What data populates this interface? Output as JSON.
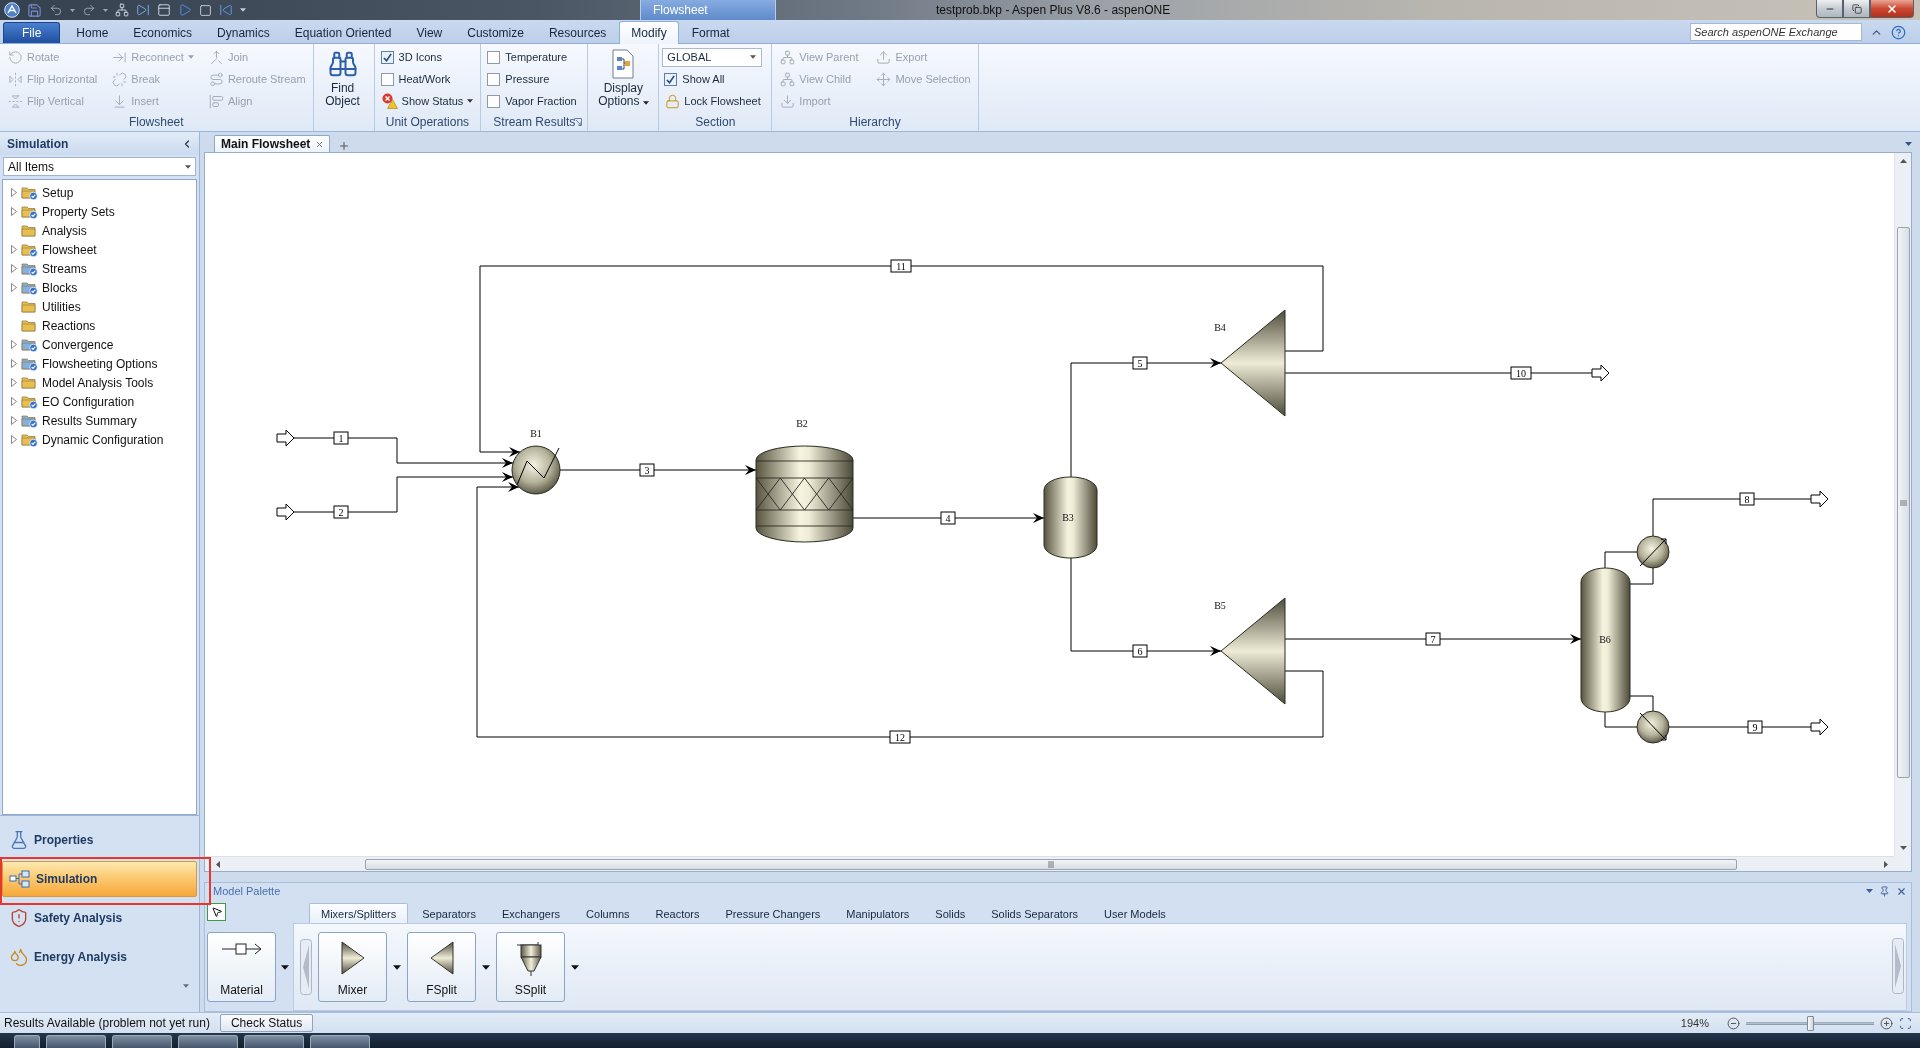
{
  "window": {
    "title": "testprob.bkp - Aspen Plus V8.6 - aspenONE",
    "context_tab": "Flowsheet"
  },
  "ribbon": {
    "tabs": [
      {
        "label": "File",
        "kind": "file",
        "selected": false
      },
      {
        "label": "Home",
        "kind": "tab",
        "selected": false
      },
      {
        "label": "Economics",
        "kind": "tab",
        "selected": false
      },
      {
        "label": "Dynamics",
        "kind": "tab",
        "selected": false
      },
      {
        "label": "Equation Oriented",
        "kind": "tab",
        "selected": false
      },
      {
        "label": "View",
        "kind": "tab",
        "selected": false
      },
      {
        "label": "Customize",
        "kind": "tab",
        "selected": false
      },
      {
        "label": "Resources",
        "kind": "tab",
        "selected": false
      },
      {
        "label": "Modify",
        "kind": "tab",
        "selected": true
      },
      {
        "label": "Format",
        "kind": "tab",
        "selected": false
      }
    ],
    "search": {
      "placeholder": "Search aspenONE Exchange"
    },
    "groups": [
      {
        "label": "Flowsheet",
        "launcher": false,
        "items": [
          {
            "kind": "small",
            "label": "Rotate",
            "disabled": true,
            "menu": false
          },
          {
            "kind": "small",
            "label": "Flip Horizontal",
            "disabled": true,
            "menu": false
          },
          {
            "kind": "small",
            "label": "Flip Vertical",
            "disabled": true,
            "menu": false
          },
          {
            "kind": "small",
            "label": "Reconnect",
            "disabled": true,
            "menu": true
          },
          {
            "kind": "small",
            "label": "Break",
            "disabled": true,
            "menu": false
          },
          {
            "kind": "small",
            "label": "Insert",
            "disabled": true,
            "menu": false
          },
          {
            "kind": "small",
            "label": "Join",
            "disabled": true,
            "menu": false
          },
          {
            "kind": "small",
            "label": "Reroute Stream",
            "disabled": true,
            "menu": false
          },
          {
            "kind": "small",
            "label": "Align",
            "disabled": true,
            "menu": false
          }
        ]
      },
      {
        "launcher": false,
        "items": [
          {
            "kind": "large",
            "label": "Find Object",
            "disabled": false,
            "menu": false
          }
        ]
      },
      {
        "label": "Unit Operations",
        "launcher": false,
        "items": [
          {
            "kind": "checkbox",
            "label": "3D Icons",
            "checked": true
          },
          {
            "kind": "checkbox",
            "label": "Heat/Work",
            "checked": false
          },
          {
            "kind": "small",
            "label": "Show Status",
            "disabled": false,
            "menu": true
          }
        ]
      },
      {
        "label": "Stream Results",
        "launcher": true,
        "items": [
          {
            "kind": "checkbox",
            "label": "Temperature",
            "checked": false
          },
          {
            "kind": "checkbox",
            "label": "Pressure",
            "checked": false
          },
          {
            "kind": "checkbox",
            "label": "Vapor Fraction",
            "checked": false
          }
        ]
      },
      {
        "launcher": false,
        "items": [
          {
            "kind": "large",
            "label": "Display Options",
            "disabled": false,
            "menu": true
          }
        ]
      },
      {
        "label": "Section",
        "launcher": false,
        "items": [
          {
            "kind": "select",
            "value": "GLOBAL"
          },
          {
            "kind": "checkbox",
            "label": "Show All",
            "checked": true
          },
          {
            "kind": "small",
            "label": "Lock Flowsheet",
            "disabled": false,
            "menu": false
          }
        ]
      },
      {
        "label": "Hierarchy",
        "launcher": false,
        "items": [
          {
            "kind": "small",
            "label": "View Parent",
            "disabled": true,
            "menu": false
          },
          {
            "kind": "small",
            "label": "View Child",
            "disabled": true,
            "menu": false
          },
          {
            "kind": "small",
            "label": "Import",
            "disabled": true,
            "menu": false
          },
          {
            "kind": "small",
            "label": "Export",
            "disabled": true,
            "menu": false
          },
          {
            "kind": "small",
            "label": "Move Selection",
            "disabled": true,
            "menu": false
          }
        ]
      }
    ]
  },
  "navigator": {
    "title": "Simulation",
    "filter": "All Items",
    "items": [
      {
        "label": "Setup",
        "expandable": true,
        "complete": true,
        "color": "#e8bf4f"
      },
      {
        "label": "Property Sets",
        "expandable": true,
        "complete": true,
        "color": "#e8bf4f"
      },
      {
        "label": "Analysis",
        "expandable": false,
        "complete": false,
        "color": "#e8bf4f"
      },
      {
        "label": "Flowsheet",
        "expandable": true,
        "complete": true,
        "color": "#e8bf4f"
      },
      {
        "label": "Streams",
        "expandable": true,
        "complete": true,
        "color": "#86b0da"
      },
      {
        "label": "Blocks",
        "expandable": true,
        "complete": true,
        "color": "#86b0da"
      },
      {
        "label": "Utilities",
        "expandable": false,
        "complete": false,
        "color": "#e8bf4f"
      },
      {
        "label": "Reactions",
        "expandable": false,
        "complete": false,
        "color": "#e8bf4f"
      },
      {
        "label": "Convergence",
        "expandable": true,
        "complete": true,
        "color": "#86b0da"
      },
      {
        "label": "Flowsheeting Options",
        "expandable": true,
        "complete": true,
        "color": "#86b0da"
      },
      {
        "label": "Model Analysis Tools",
        "expandable": true,
        "complete": false,
        "color": "#e8bf4f"
      },
      {
        "label": "EO Configuration",
        "expandable": true,
        "complete": true,
        "color": "#e8bf4f"
      },
      {
        "label": "Results Summary",
        "expandable": true,
        "complete": true,
        "color": "#86b0da"
      },
      {
        "label": "Dynamic Configuration",
        "expandable": true,
        "complete": true,
        "color": "#e8bf4f"
      }
    ]
  },
  "modules": [
    {
      "label": "Properties",
      "selected": false,
      "highlighted": false
    },
    {
      "label": "Simulation",
      "selected": true,
      "highlighted": true
    },
    {
      "label": "Safety Analysis",
      "selected": false,
      "highlighted": false
    },
    {
      "label": "Energy Analysis",
      "selected": false,
      "highlighted": false
    }
  ],
  "documents": [
    {
      "label": "Main Flowsheet",
      "selected": true
    }
  ],
  "flowsheet": {
    "blocks": [
      {
        "label": "B1",
        "kind": "heater"
      },
      {
        "label": "B2",
        "kind": "reactor"
      },
      {
        "label": "B3",
        "kind": "flash"
      },
      {
        "label": "B4",
        "kind": "splitter"
      },
      {
        "label": "B5",
        "kind": "splitter"
      },
      {
        "label": "B6",
        "kind": "column"
      }
    ],
    "streams": [
      {
        "label": "1",
        "kind": "feed"
      },
      {
        "label": "2",
        "kind": "feed"
      },
      {
        "label": "3",
        "kind": "internal"
      },
      {
        "label": "4",
        "kind": "internal"
      },
      {
        "label": "5",
        "kind": "internal"
      },
      {
        "label": "6",
        "kind": "internal"
      },
      {
        "label": "7",
        "kind": "internal"
      },
      {
        "label": "8",
        "kind": "product"
      },
      {
        "label": "9",
        "kind": "product"
      },
      {
        "label": "10",
        "kind": "product"
      },
      {
        "label": "11",
        "kind": "internal"
      },
      {
        "label": "12",
        "kind": "internal"
      }
    ]
  },
  "palette": {
    "title": "Model Palette",
    "tabs": [
      {
        "label": "Mixers/Splitters",
        "selected": true
      },
      {
        "label": "Separators",
        "selected": false
      },
      {
        "label": "Exchangers",
        "selected": false
      },
      {
        "label": "Columns",
        "selected": false
      },
      {
        "label": "Reactors",
        "selected": false
      },
      {
        "label": "Pressure Changers",
        "selected": false
      },
      {
        "label": "Manipulators",
        "selected": false
      },
      {
        "label": "Solids",
        "selected": false
      },
      {
        "label": "Solids Separators",
        "selected": false
      },
      {
        "label": "User Models",
        "selected": false
      }
    ],
    "items": [
      {
        "label": "Material",
        "kind": "stream"
      },
      {
        "label": "Mixer",
        "kind": "mixer"
      },
      {
        "label": "FSplit",
        "kind": "fsplit"
      },
      {
        "label": "SSplit",
        "kind": "ssplit"
      }
    ]
  },
  "status_bar": {
    "message": "Results Available (problem not yet run)",
    "button": "Check Status",
    "zoom": "194%",
    "zoom_slider": {
      "level": 0.5
    }
  }
}
